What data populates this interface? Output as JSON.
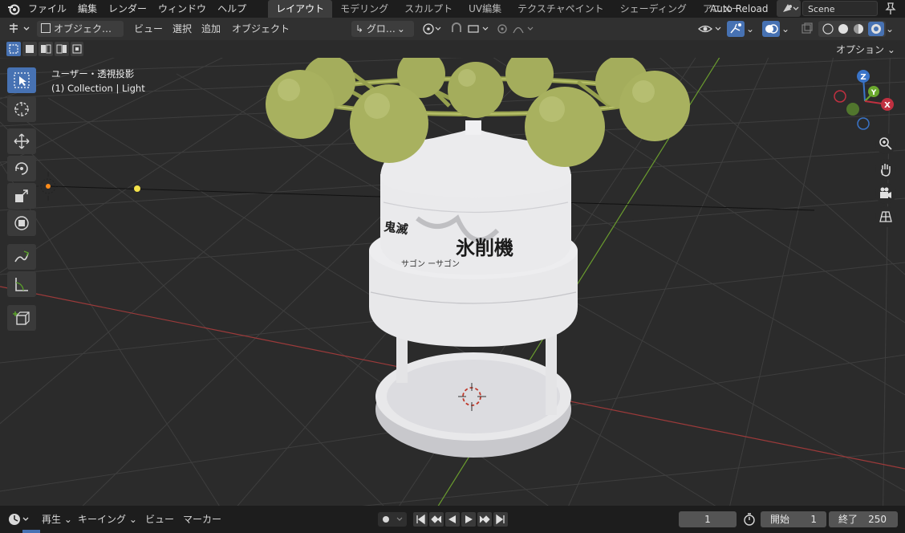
{
  "topbar": {
    "menu": [
      "ファイル",
      "編集",
      "レンダー",
      "ウィンドウ",
      "ヘルプ"
    ],
    "workspaces": [
      "レイアウト",
      "モデリング",
      "スカルプト",
      "UV編集",
      "テクスチャペイント",
      "シェーディング",
      "アニメー"
    ],
    "active_workspace": "レイアウト",
    "auto_reload": "Auto Reload",
    "scene": "Scene"
  },
  "header": {
    "mode": "オブジェク…",
    "view": "ビュー",
    "select": "選択",
    "add": "追加",
    "object": "オブジェクト",
    "transform": "グロ…"
  },
  "viewport": {
    "view_label": "ユーザー・透視投影",
    "collection_label": "(1) Collection | Light",
    "options": "オプション",
    "label_left_top": "鬼滅",
    "label_main": "氷削機",
    "label_sub": "サゴン ーサゴン"
  },
  "gizmo": {
    "z": "Z",
    "y": "Y",
    "x": "X"
  },
  "timeline": {
    "playback": "再生",
    "keying": "キーイング",
    "view": "ビュー",
    "marker": "マーカー",
    "current_frame": "1",
    "start_label": "開始",
    "start_value": "1",
    "end_label": "終了",
    "end_value": "250"
  },
  "colors": {
    "accent": "#4772b3",
    "ball": "#a4ad5c",
    "body": "#e8e8ea",
    "grid_x": "#9c3a3a",
    "grid_y": "#6a9c2e"
  }
}
